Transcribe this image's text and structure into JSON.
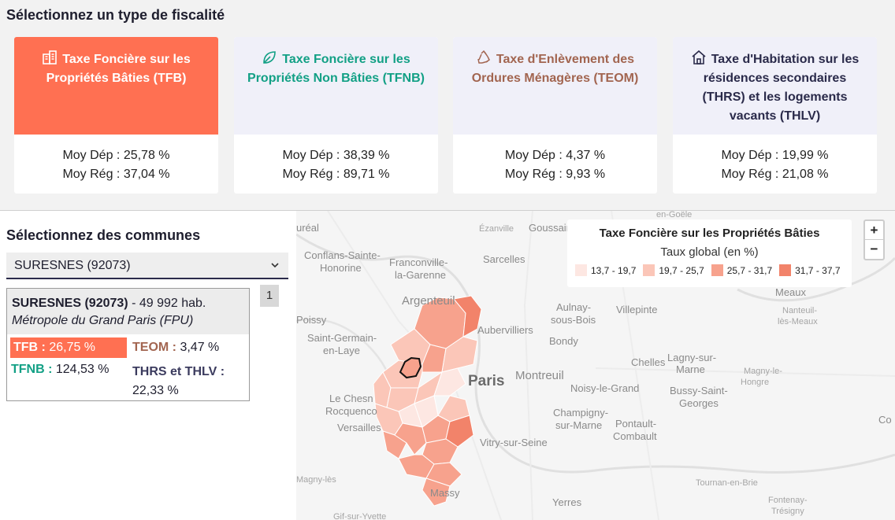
{
  "header": {
    "title": "Sélectionnez un type de fiscalité"
  },
  "cards": [
    {
      "title": "Taxe Foncière sur les Propriétés Bâties (TFB)",
      "icon": "building-icon",
      "dep": "Moy Dép : 25,78 %",
      "reg": "Moy Rég : 37,04 %",
      "color": "#ff7052",
      "active": true
    },
    {
      "title": "Taxe Foncière sur les Propriétés Non Bâties (TFNB)",
      "icon": "leaf-icon",
      "dep": "Moy Dép : 38,39 %",
      "reg": "Moy Rég : 89,71 %",
      "color": "#12a085",
      "active": false
    },
    {
      "title": "Taxe d'Enlèvement des Ordures Ménagères (TEOM)",
      "icon": "recycle-icon",
      "dep": "Moy Dép : 4,37 %",
      "reg": "Moy Rég : 9,93 %",
      "color": "#a26550",
      "active": false
    },
    {
      "title": "Taxe d'Habitation sur les résidences secondaires (THRS) et les logements vacants (THLV)",
      "icon": "house-icon",
      "dep": "Moy Dép : 19,99 %",
      "reg": "Moy Rég : 21,08 %",
      "color": "#2a2a4a",
      "active": false
    }
  ],
  "communes": {
    "title": "Sélectionnez des communes",
    "selected": "SURESNES (92073)",
    "count": "1",
    "info": {
      "name": "SURESNES (92073)",
      "population": " - 49 992 hab.",
      "epci": "Métropole du Grand Paris (FPU)",
      "tfb_label": "TFB :",
      "tfb_value": " 26,75 %",
      "teom_label": "TEOM :",
      "teom_value": " 3,47 %",
      "tfnb_label": "TFNB :",
      "tfnb_value": " 124,53 %",
      "thrs_label": "THRS et THLV :",
      "thrs_value": "22,33 %"
    }
  },
  "legend": {
    "title": "Taxe Foncière sur les Propriétés Bâties",
    "subtitle": "Taux global (en %)",
    "items": [
      {
        "label": "13,7 - 19,7",
        "color": "#fde7e2"
      },
      {
        "label": "19,7 - 25,7",
        "color": "#fbc6b8"
      },
      {
        "label": "25,7 - 31,7",
        "color": "#f7a28d"
      },
      {
        "label": "31,7 - 37,7",
        "color": "#f2836a"
      }
    ]
  },
  "zoom": {
    "in": "+",
    "out": "−"
  },
  "places": {
    "en_goele": "en-Goële",
    "ezanville": "Ézanville",
    "goussain": "Goussain",
    "ureal": "uréal",
    "conflans": "Conflans-Sainte-",
    "honorine": "Honorine",
    "franconville": "Franconville-",
    "la_garenne": "la-Garenne",
    "sarcelles": "Sarcelles",
    "argenteuil": "Argenteuil",
    "aulnay": "Aulnay-",
    "sous_bois": "sous-Bois",
    "villepinte": "Villepinte",
    "meaux": "Meaux",
    "nanteuil1": "Nanteuil-",
    "nanteuil2": "lès-Meaux",
    "poissy": "Poissy",
    "aubervilliers": "Aubervilliers",
    "bondy": "Bondy",
    "saint_germain": "Saint-Germain-",
    "en_laye": "en-Laye",
    "montreuil": "Montreuil",
    "chelles": "Chelles",
    "lagny1": "Lagny-sur-",
    "lagny2": "Marne",
    "magny1": "Magny-le-",
    "magny2": "Hongre",
    "paris": "Paris",
    "noisy": "Noisy-le-Grand",
    "bussy1": "Bussy-Saint-",
    "bussy2": "Georges",
    "chesnay": "Le Chesn",
    "rocquencourt": "Rocquenco",
    "champigny1": "Champigny-",
    "champigny2": "sur-Marne",
    "versailles": "Versailles",
    "pontault1": "Pontault-",
    "pontault2": "Combault",
    "vitry": "Vitry-sur-Seine",
    "co": "Co",
    "magny_vallee": "Magny-lès",
    "massy": "Massy",
    "tournan": "Tournan-en-Brie",
    "yerres": "Yerres",
    "gif": "Gif-sur-Yvette",
    "fontenay1": "Fontenay-",
    "fontenay2": "Trésigny"
  }
}
